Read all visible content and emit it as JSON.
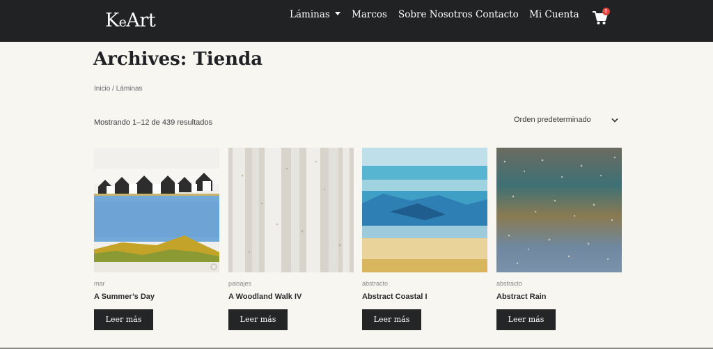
{
  "brand": {
    "logo_text_k": "K",
    "logo_text_e": "e",
    "logo_text_art": "Art"
  },
  "nav": {
    "items": [
      {
        "label": "Láminas",
        "has_dropdown": true
      },
      {
        "label": "Marcos"
      },
      {
        "label": "Sobre Nosotros"
      },
      {
        "label": "Contacto"
      },
      {
        "label": "Mi Cuenta"
      }
    ],
    "cart_count": "0",
    "cart_icon": "shopping-cart-icon"
  },
  "page": {
    "title": "Archives: Tienda",
    "breadcrumb": {
      "home": "Inicio",
      "separator": "/",
      "current": "Láminas"
    },
    "result_count": "Mostrando 1–12 de 439 resultados",
    "orderby": {
      "selected": "Orden predeterminado",
      "icon": "chevron-down-icon"
    }
  },
  "products": [
    {
      "category": "mar",
      "name": "A Summer’s Day",
      "button": "Leer más"
    },
    {
      "category": "paisajes",
      "name": "A Woodland Walk IV",
      "button": "Leer más"
    },
    {
      "category": "abstracto",
      "name": "Abstract Coastal I",
      "button": "Leer más"
    },
    {
      "category": "abstracto",
      "name": "Abstract Rain",
      "button": "Leer más"
    }
  ],
  "colors": {
    "header_bg": "#202224",
    "page_bg": "#f8f6f1",
    "button_bg": "#232527",
    "badge": "#e0463d"
  }
}
